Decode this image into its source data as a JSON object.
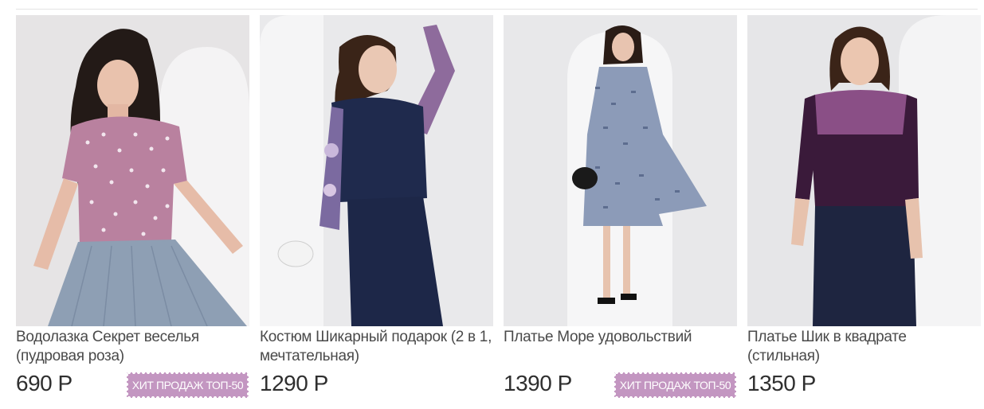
{
  "products": [
    {
      "title": "Водолазка Секрет веселья (пудровая роза)",
      "price": "690 Р",
      "badge": "ХИТ ПРОДАЖ ТОП-50",
      "image_alt": "Model in pink polka-dot top and blue pleated skirt"
    },
    {
      "title": "Костюм Шикарный подарок (2 в 1, мечтательная)",
      "price": "1290 Р",
      "badge": "",
      "image_alt": "Model in navy suit with floral sleeves"
    },
    {
      "title": "Платье Море удовольствий",
      "price": "1390 Р",
      "badge": "ХИТ ПРОДАЖ ТОП-50",
      "image_alt": "Model in blue patterned chiffon dress"
    },
    {
      "title": "Платье Шик в квадрате (стильная)",
      "price": "1350 Р",
      "badge": "",
      "image_alt": "Model in color-block purple and navy dress"
    }
  ],
  "colors": {
    "badge_bg": "#c396c1",
    "badge_text": "#ffffff",
    "price_text": "#2f2f2f",
    "title_text": "#4a4a4a"
  }
}
